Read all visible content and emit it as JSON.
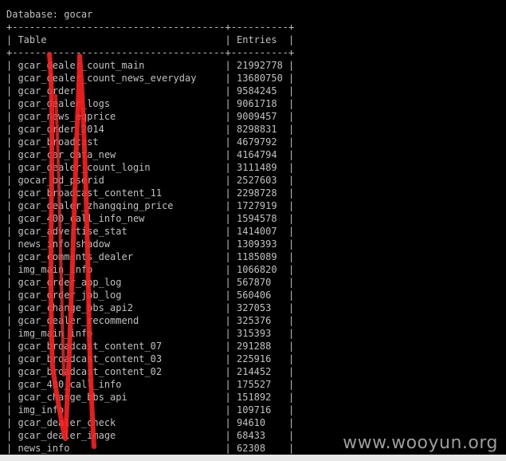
{
  "console": {
    "header": "Database: gocar",
    "border_top": "+-------------------------------------+----------+",
    "column_header_table": "Table",
    "column_header_entries": "Entries",
    "border_mid": "+-------------------------------------+----------+",
    "rows": [
      {
        "table": "gcar_dealer_count_main",
        "entries": "21992778"
      },
      {
        "table": "gcar_dealer_count_news_everyday",
        "entries": "13680750"
      },
      {
        "table": "gcar_order",
        "entries": "9584245"
      },
      {
        "table": "gcar_dealer_logs",
        "entries": "9061718"
      },
      {
        "table": "gcar_news_eqprice",
        "entries": "9009457"
      },
      {
        "table": "gcar_order_2014",
        "entries": "8298831"
      },
      {
        "table": "gcar_broadcast",
        "entries": "4679792"
      },
      {
        "table": "gcar_car_data_new",
        "entries": "4164794"
      },
      {
        "table": "gcar_dealer_count_login",
        "entries": "3111489"
      },
      {
        "table": "gocar_bd_pserid",
        "entries": "2527603"
      },
      {
        "table": "gcar_broadcast_content_11",
        "entries": "2298728"
      },
      {
        "table": "gcar_dealer_zhangqing_price",
        "entries": "1727919"
      },
      {
        "table": "gcar_400_call_info_new",
        "entries": "1594578"
      },
      {
        "table": "gcar_advertise_stat",
        "entries": "1414007"
      },
      {
        "table": "news_info_shadow",
        "entries": "1309393"
      },
      {
        "table": "gcar_comments_dealer",
        "entries": "1185089"
      },
      {
        "table": "img_main_info",
        "entries": "1066820"
      },
      {
        "table": "gcar_order_app_log",
        "entries": "567870"
      },
      {
        "table": "gcar_order_job_log",
        "entries": "560406"
      },
      {
        "table": "gcar_change_bbs_api2",
        "entries": "327053"
      },
      {
        "table": "gcar_dealer_recommend",
        "entries": "325376"
      },
      {
        "table": "img_main_info",
        "entries": "315393"
      },
      {
        "table": "gcar_broadcast_content_07",
        "entries": "291288"
      },
      {
        "table": "gcar_broadcast_content_03",
        "entries": "225916"
      },
      {
        "table": "gcar_broadcast_content_02",
        "entries": "214452"
      },
      {
        "table": "gcar_400_call_info",
        "entries": "175527"
      },
      {
        "table": "gcar_change_bbs_api",
        "entries": "151892"
      },
      {
        "table": "img_info",
        "entries": "109716"
      },
      {
        "table": "gcar_dealer_check",
        "entries": "94610"
      },
      {
        "table": "gcar_dealer_image",
        "entries": "68433"
      },
      {
        "table": "news_info",
        "entries": "62308"
      }
    ]
  },
  "watermark": "www.wooyun.org",
  "colors": {
    "background": "#000000",
    "text": "#c0c0c0",
    "scribble": "#ff2020"
  }
}
